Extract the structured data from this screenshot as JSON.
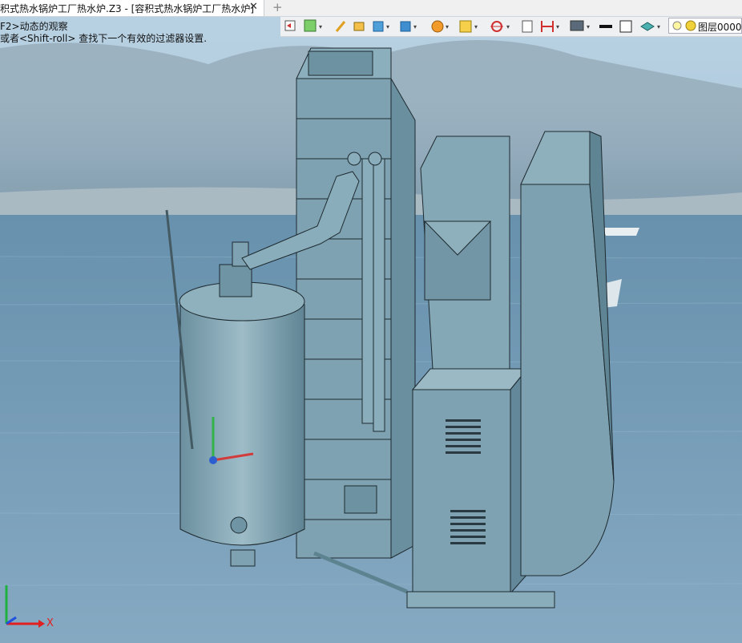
{
  "tab": {
    "title": "积式热水锅炉工厂热水炉.Z3 - [容积式热水锅炉工厂热水炉]",
    "close_glyph": "✕",
    "add_glyph": "+"
  },
  "toolbar": {
    "items": [
      "undo-icon",
      "paint-icon",
      "pencil-icon",
      "box-icon",
      "cube-icon",
      "view-cube-icon",
      "render-sphere-icon",
      "texture-icon",
      "origin-icon",
      "sheet-icon",
      "dimension-icon",
      "monitor-icon",
      "line-weight-icon",
      "square-icon",
      "layers-icon"
    ]
  },
  "layer": {
    "name": "图层0000"
  },
  "hints": {
    "line1": "F2>动态的观察",
    "line2": "或者<Shift-roll> 查找下一个有效的过滤器设置."
  },
  "triad": {
    "x_label": "X"
  },
  "colors": {
    "part": "#7fa3b2",
    "part_dark": "#5d8391",
    "edge": "#1e2a30",
    "sky": "#b9d2e3",
    "water": "#5a84a2"
  }
}
